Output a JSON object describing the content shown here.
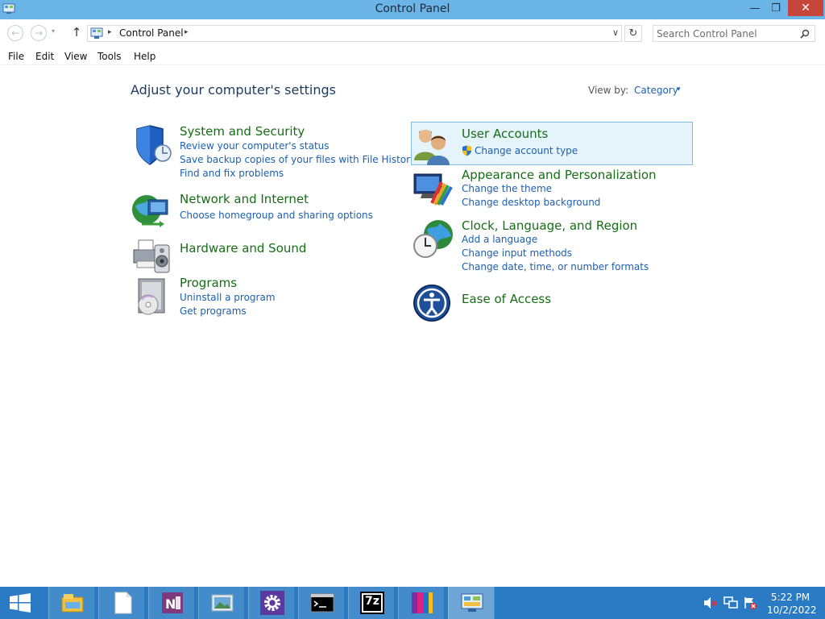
{
  "window": {
    "title": "Control Panel",
    "minimize_label": "—",
    "restore_label": "❐",
    "close_label": "✕"
  },
  "nav": {
    "back_label": "←",
    "forward_label": "→",
    "recent_label": "▾",
    "up_label": "↑",
    "breadcrumb": "Control Panel",
    "breadcrumb_sep": "▸",
    "address_dropdown": "∨",
    "refresh_label": "↻",
    "search_placeholder": "Search Control Panel",
    "search_value": ""
  },
  "menu": [
    "File",
    "Edit",
    "View",
    "Tools",
    "Help"
  ],
  "content": {
    "heading": "Adjust your computer's settings",
    "view_by_label": "View by:",
    "view_by_value": "Category",
    "view_by_arrow": "▾"
  },
  "categories_left": [
    {
      "title": "System and Security",
      "icon": "shield-icon",
      "links": [
        "Review your computer's status",
        "Save backup copies of your files with File History",
        "Find and fix problems"
      ]
    },
    {
      "title": "Network and Internet",
      "icon": "network-globe-icon",
      "links": [
        "Choose homegroup and sharing options"
      ]
    },
    {
      "title": "Hardware and Sound",
      "icon": "printer-speaker-icon",
      "links": []
    },
    {
      "title": "Programs",
      "icon": "programs-disc-icon",
      "links": [
        "Uninstall a program",
        "Get programs"
      ]
    }
  ],
  "categories_right": [
    {
      "title": "User Accounts",
      "icon": "users-icon",
      "links": [
        "Change account type"
      ],
      "highlighted": true
    },
    {
      "title": "Appearance and Personalization",
      "icon": "monitor-palette-icon",
      "links": [
        "Change the theme",
        "Change desktop background"
      ]
    },
    {
      "title": "Clock, Language, and Region",
      "icon": "clock-globe-icon",
      "links": [
        "Add a language",
        "Change input methods",
        "Change date, time, or number formats"
      ]
    },
    {
      "title": "Ease of Access",
      "icon": "ease-of-access-icon",
      "links": []
    }
  ],
  "taskbar": {
    "apps": [
      {
        "name": "file-explorer-icon"
      },
      {
        "name": "notepad-icon"
      },
      {
        "name": "onenote-icon"
      },
      {
        "name": "photo-viewer-icon"
      },
      {
        "name": "settings-gear-icon"
      },
      {
        "name": "command-prompt-icon"
      },
      {
        "name": "7zip-icon",
        "label": "7z"
      },
      {
        "name": "winrar-icon"
      },
      {
        "name": "control-panel-icon",
        "active": true
      }
    ],
    "clock_time": "5:22 PM",
    "clock_date": "10/2/2022"
  },
  "colors": {
    "titlebar": "#6bb4e7",
    "taskbar": "#2a7bc4",
    "category_title": "#166d16",
    "link": "#1e5fae",
    "highlight": "#e5f3fb"
  }
}
